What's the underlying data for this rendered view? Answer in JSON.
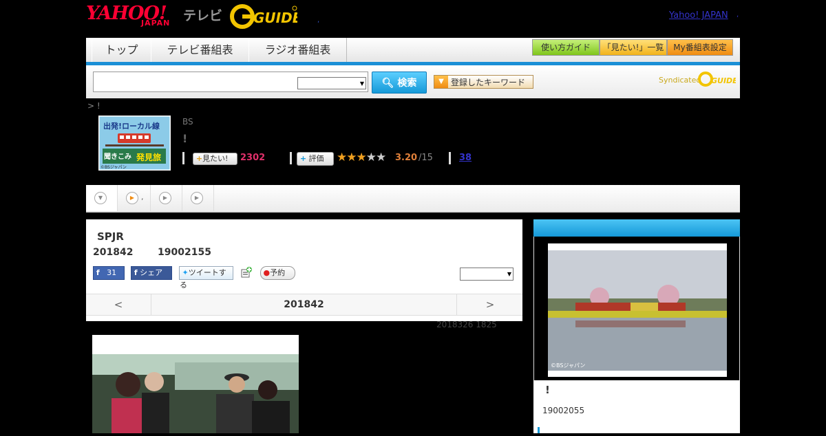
{
  "header": {
    "logo_yahoo": "YAHOO!",
    "logo_japan": "JAPAN",
    "logo_tv": "テレビ",
    "logo_gguide": "GUIDE",
    "top_link": "Yahoo! JAPAN"
  },
  "nav": {
    "tabs": [
      "トップ",
      "テレビ番組表",
      "ラジオ番組表"
    ],
    "buttons": [
      "使い方ガイド",
      "「見たい!」一覧",
      "My番組表設定"
    ]
  },
  "search": {
    "placeholder": "",
    "button_label": "検索",
    "keyword_button": "登録したキーワード",
    "syndicated": "Syndicated",
    "syndicated_logo": "GUIDE"
  },
  "breadcrumb": "> !",
  "program": {
    "channel": "BS",
    "title": "!",
    "thumb_line1": "出発!ローカル線",
    "thumb_line2": "聞きこみ",
    "thumb_line3": "発見旅",
    "thumb_credit": "©BSジャパン",
    "mitai_label": "見たい!",
    "mitai_count": "2302",
    "rate_label": "評価",
    "rating_stars": 3.2,
    "rating_value": "3.20",
    "rating_max": "/15",
    "review_count": "38"
  },
  "subtabs": {
    "second_label": ","
  },
  "episode": {
    "title": "SPJR",
    "date": "201842",
    "time": "19002155",
    "fb_like_count": "31",
    "fb_share": "シェア",
    "tweet": "ツイートする",
    "reserve": "予約",
    "pager_prev": "<",
    "pager_date": "201842",
    "pager_next": ">",
    "updated": "2018326  1825"
  },
  "right": {
    "photo_credit": "©BSジャパン",
    "title": "!",
    "date": "19002055"
  },
  "colors": {
    "accent_blue": "#1599d8",
    "yahoo_red": "#ff0033",
    "mitai_pink": "#e0306a",
    "rating_orange": "#e0803a"
  }
}
